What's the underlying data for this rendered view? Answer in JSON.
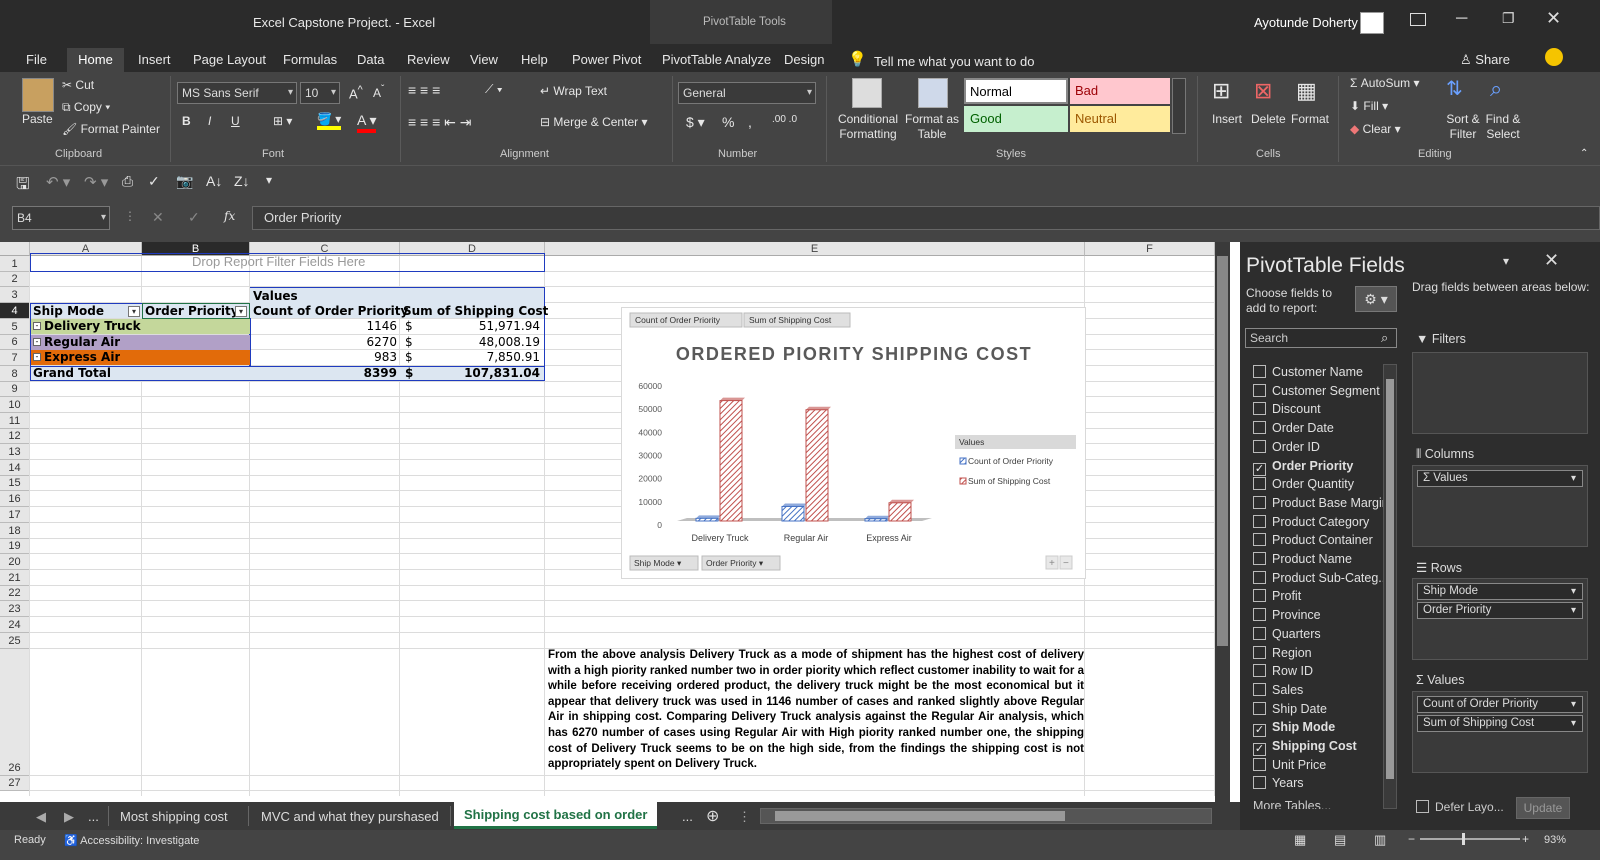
{
  "window": {
    "title": "Excel Capstone Project.  -  Excel",
    "tools_title": "PivotTable Tools",
    "user": "Ayotunde Doherty"
  },
  "tabs": [
    "File",
    "Home",
    "Insert",
    "Page Layout",
    "Formulas",
    "Data",
    "Review",
    "View",
    "Help",
    "Power Pivot",
    "PivotTable Analyze",
    "Design"
  ],
  "tell_me": "Tell me what you want to do",
  "share": "Share",
  "ribbon": {
    "clipboard": {
      "paste": "Paste",
      "cut": "Cut",
      "copy": "Copy",
      "format_painter": "Format Painter",
      "label": "Clipboard"
    },
    "font": {
      "name": "MS Sans Serif",
      "size": "10",
      "bold": "B",
      "italic": "I",
      "underline": "U",
      "label": "Font"
    },
    "alignment": {
      "wrap": "Wrap Text",
      "merge": "Merge & Center",
      "label": "Alignment"
    },
    "number": {
      "format": "General",
      "currency": "$",
      "percent": "%",
      "comma": ",",
      "label": "Number"
    },
    "styles": {
      "cond": "Conditional Formatting",
      "table": "Format as Table",
      "normal": "Normal",
      "bad": "Bad",
      "good": "Good",
      "neutral": "Neutral",
      "label": "Styles"
    },
    "cells": {
      "insert": "Insert",
      "delete": "Delete",
      "format": "Format",
      "label": "Cells"
    },
    "editing": {
      "autosum": "AutoSum",
      "fill": "Fill",
      "clear": "Clear",
      "sort": "Sort & Filter",
      "find": "Find & Select",
      "label": "Editing"
    }
  },
  "formula_bar": {
    "name_box": "B4",
    "fx": "fx",
    "content": "Order Priority"
  },
  "columns": [
    "A",
    "B",
    "C",
    "D",
    "E",
    "F"
  ],
  "pivot": {
    "filter_hint": "Drop Report Filter Fields Here",
    "values_label": "Values",
    "headers": [
      "Ship Mode",
      "Order Priority",
      "Count of Order Priority",
      "Sum of Shipping Cost"
    ],
    "rows": [
      {
        "mode": "Delivery Truck",
        "count": "1146",
        "cur": "$",
        "cost": "51,971.94",
        "color": "#c4d79b"
      },
      {
        "mode": "Regular Air",
        "count": "6270",
        "cur": "$",
        "cost": "48,008.19",
        "color": "#b1a0c7"
      },
      {
        "mode": "Express Air",
        "count": "983",
        "cur": "$",
        "cost": "7,850.91",
        "color": "#e26b0a"
      }
    ],
    "total": {
      "label": "Grand Total",
      "count": "8399",
      "cur": "$",
      "cost": "107,831.04"
    }
  },
  "chart_data": {
    "type": "bar",
    "title": "ORDERED PIORITY SHIPPING COST",
    "categories": [
      "Delivery Truck",
      "Regular Air",
      "Express Air"
    ],
    "series": [
      {
        "name": "Count of Order Priority",
        "values": [
          1146,
          6270,
          983
        ],
        "color": "#4472c4"
      },
      {
        "name": "Sum of Shipping Cost",
        "values": [
          51971.94,
          48008.19,
          7850.91
        ],
        "color": "#c0504d"
      }
    ],
    "ylim": [
      0,
      60000
    ],
    "yticks": [
      "60000",
      "50000",
      "40000",
      "30000",
      "20000",
      "10000",
      "0"
    ],
    "legend_title": "Values",
    "legend_position": "right",
    "field_buttons": [
      "Count of Order Priority",
      "Sum of Shipping Cost"
    ],
    "axis_buttons": [
      "Ship Mode",
      "Order Priority"
    ]
  },
  "analysis": "From the above analysis Delivery Truck as a mode of shipment has the highest cost of delivery with a high piority ranked number two in order piority which reflect customer inability to wait for a while before receiving ordered product, the delivery truck might be the most economical but it appear that delivery truck was used in 1146 number of cases and ranked slightly above Regular Air in shipping cost. Comparing  Delivery Truck analysis against the Regular Air analysis, which has  6270 number of cases using Regular Air with High piority ranked number one, the shipping cost of Delivery Truck seems to be on the high side, from the findings the shipping cost is not appropriately spent on Delivery Truck.",
  "fields_pane": {
    "title": "PivotTable Fields",
    "choose": "Choose fields to add to report:",
    "drag": "Drag fields between areas below:",
    "search": "Search",
    "fields": [
      {
        "name": "Customer Name",
        "checked": false
      },
      {
        "name": "Customer Segment",
        "checked": false
      },
      {
        "name": "Discount",
        "checked": false
      },
      {
        "name": "Order Date",
        "checked": false
      },
      {
        "name": "Order ID",
        "checked": false
      },
      {
        "name": "Order Priority",
        "checked": true
      },
      {
        "name": "Order Quantity",
        "checked": false
      },
      {
        "name": "Product Base Margin",
        "checked": false
      },
      {
        "name": "Product Category",
        "checked": false
      },
      {
        "name": "Product Container",
        "checked": false
      },
      {
        "name": "Product Name",
        "checked": false
      },
      {
        "name": "Product Sub-Categ...",
        "checked": false
      },
      {
        "name": "Profit",
        "checked": false
      },
      {
        "name": "Province",
        "checked": false
      },
      {
        "name": "Quarters",
        "checked": false
      },
      {
        "name": "Region",
        "checked": false
      },
      {
        "name": "Row ID",
        "checked": false
      },
      {
        "name": "Sales",
        "checked": false
      },
      {
        "name": "Ship Date",
        "checked": false
      },
      {
        "name": "Ship Mode",
        "checked": true
      },
      {
        "name": "Shipping Cost",
        "checked": true
      },
      {
        "name": "Unit Price",
        "checked": false
      },
      {
        "name": "Years",
        "checked": false
      }
    ],
    "more_tables": "More Tables...",
    "filters": "Filters",
    "columns": "Columns",
    "rows": "Rows",
    "values": "Values",
    "columns_items": [
      "Σ  Values"
    ],
    "rows_items": [
      "Ship Mode",
      "Order Priority"
    ],
    "values_items": [
      "Count of Order Priority",
      "Sum of Shipping Cost"
    ],
    "defer": "Defer Layo...",
    "update": "Update"
  },
  "sheets": [
    "Most shipping cost",
    "MVC and what they purshased",
    "Shipping cost based on order"
  ],
  "status": {
    "ready": "Ready",
    "accessibility": "Accessibility: Investigate",
    "zoom": "93%"
  }
}
